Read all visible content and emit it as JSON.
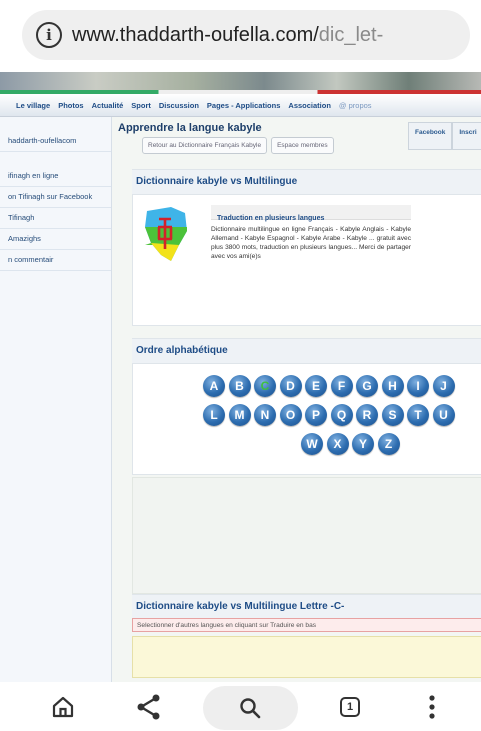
{
  "browser": {
    "url_main": "www.thaddarth-oufella.com/",
    "url_dim": "dic_let-"
  },
  "nav": {
    "items": [
      "Le village",
      "Photos",
      "Actualité",
      "Sport",
      "Discussion",
      "Pages - Applications",
      "Association",
      "@ propos"
    ]
  },
  "sidebar": {
    "items": [
      "haddarth-oufellacom",
      "ifinagh en ligne",
      "on Tifinagh sur Facebook",
      "Tifinagh",
      "Amazighs",
      "n commentair"
    ]
  },
  "main": {
    "title": "Apprendre la langue kabyle",
    "buttons": [
      "Retour au Dictionnaire Français Kabyle",
      "Espace membres"
    ],
    "right_buttons": [
      "Facebook",
      "Inscri"
    ]
  },
  "dict_panel": {
    "header": "Dictionnaire kabyle vs Multilingue",
    "trad_title": "Traduction en plusieurs langues",
    "trad_desc": "Dictionnaire multilingue en ligne Français - Kabyle Anglais - Kabyle Allemand - Kabyle Espagnol - Kabyle Arabe - Kabyle ... gratuit avec plus 3800 mots, traduction en plusieurs langues... Merci de partager avec vos ami(e)s"
  },
  "alpha": {
    "header": "Ordre alphabétique",
    "row1": [
      "A",
      "B",
      "C",
      "D",
      "E",
      "F",
      "G",
      "H",
      "I",
      "J"
    ],
    "row2": [
      "L",
      "M",
      "N",
      "O",
      "P",
      "Q",
      "R",
      "S",
      "T",
      "U"
    ],
    "row3": [
      "W",
      "X",
      "Y",
      "Z"
    ],
    "active": "C",
    "colors": {
      "letter": "#2d6db0",
      "active_text": "#3fbf3f"
    }
  },
  "letter_section": {
    "header": "Dictionnaire kabyle vs Multilingue Lettre -C-",
    "notice": "Selectionner d'autres langues en cliquant sur Traduire en bas"
  },
  "bottom_nav": {
    "tab_count": "1",
    "icons": [
      "home-icon",
      "share-icon",
      "search-icon",
      "tabs-icon",
      "more-icon"
    ]
  }
}
